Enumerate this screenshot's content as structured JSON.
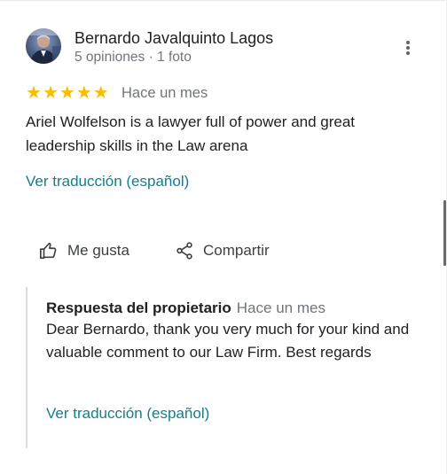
{
  "review": {
    "author": "Bernardo Javalquinto Lagos",
    "author_meta": "5 opiniones · 1 foto",
    "rating": 5,
    "stars": [
      "★",
      "★",
      "★",
      "★",
      "★"
    ],
    "date": "Hace un mes",
    "text": "Ariel Wolfelson is a lawyer full of power and great leadership skills in the Law arena",
    "translate_label": "Ver traducción (español)",
    "more_icon": "more-vert-icon"
  },
  "actions": {
    "like_label": "Me gusta",
    "like_icon": "thumb-up-icon",
    "share_label": "Compartir",
    "share_icon": "share-icon"
  },
  "owner_reply": {
    "title": "Respuesta del propietario",
    "date": "Hace un mes",
    "text": "Dear Bernardo, thank you very much for your kind and valuable comment to our Law Firm. Best regards",
    "translate_label": "Ver traducción (español)"
  },
  "colors": {
    "star": "#fbbc04",
    "link": "#137e8c",
    "secondary_text": "#70757a",
    "primary_text": "#202124"
  }
}
